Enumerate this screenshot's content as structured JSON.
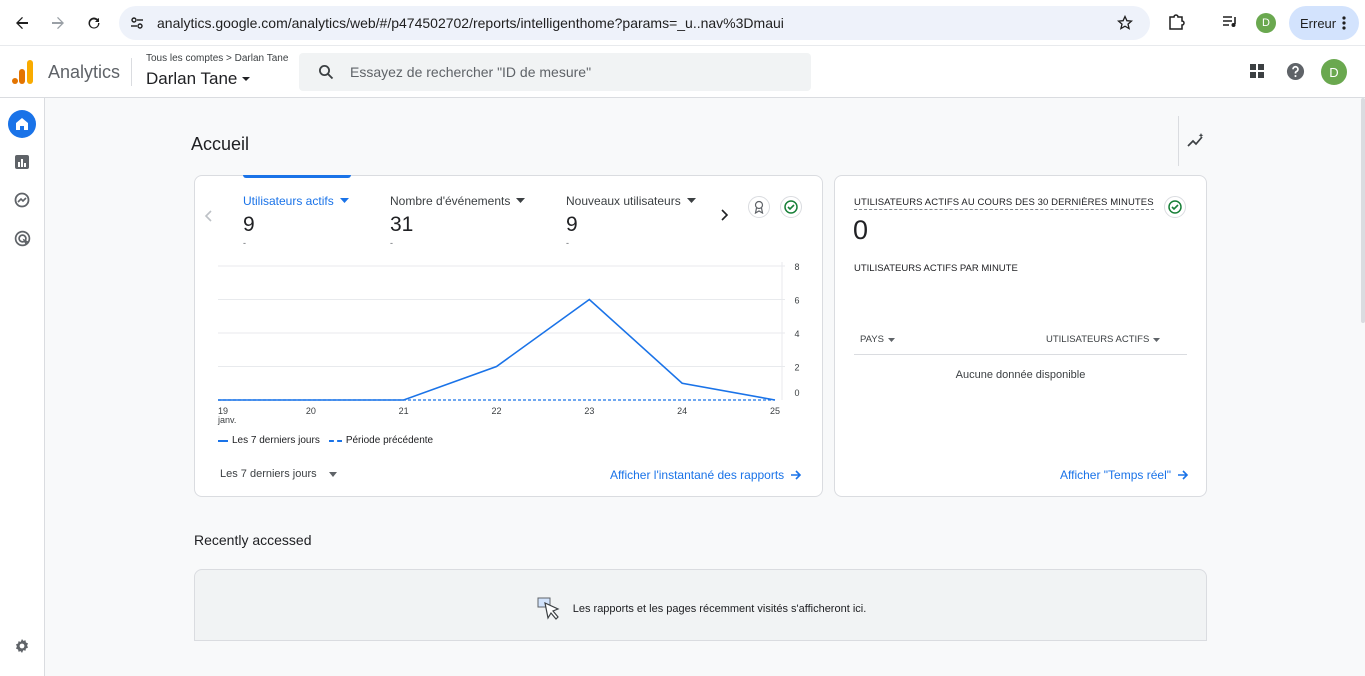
{
  "browser": {
    "url": "analytics.google.com/analytics/web/#/p474502702/reports/intelligenthome?params=_u..nav%3Dmaui",
    "profile_initial": "D",
    "error_label": "Erreur"
  },
  "header": {
    "brand": "Analytics",
    "breadcrumb": "Tous les comptes > Darlan Tane",
    "account": "Darlan Tane",
    "search_placeholder": "Essayez de rechercher \"ID de mesure\"",
    "avatar_initial": "D"
  },
  "page": {
    "title": "Accueil"
  },
  "overview_card": {
    "tabs": [
      {
        "label": "Utilisateurs actifs",
        "value": "9",
        "sub": "-"
      },
      {
        "label": "Nombre d'événements",
        "value": "31",
        "sub": "-"
      },
      {
        "label": "Nouveaux utilisateurs",
        "value": "9",
        "sub": "-"
      }
    ],
    "legend_current": "Les 7 derniers jours",
    "legend_previous": "Période précédente",
    "date_range": "Les 7 derniers jours",
    "link": "Afficher l'instantané des rapports"
  },
  "chart_data": {
    "type": "line",
    "x": [
      "19 janv.",
      "20",
      "21",
      "22",
      "23",
      "24",
      "25"
    ],
    "series": [
      {
        "name": "Les 7 derniers jours",
        "values": [
          0,
          0,
          0,
          2,
          6,
          1,
          0
        ]
      },
      {
        "name": "Période précédente",
        "values": [
          0,
          0,
          0,
          0,
          0,
          0,
          0
        ]
      }
    ],
    "y_ticks": [
      "8",
      "6",
      "4",
      "2",
      "0"
    ],
    "ylim": [
      0,
      8
    ],
    "grid": true,
    "y_axis_side": "right",
    "colors": {
      "current": "#1a73e8",
      "previous": "#1a73e8"
    }
  },
  "realtime_card": {
    "title": "UTILISATEURS ACTIFS AU COURS DES 30 DERNIÈRES MINUTES",
    "value": "0",
    "subtitle": "UTILISATEURS ACTIFS PAR MINUTE",
    "col_country": "PAYS",
    "col_users": "UTILISATEURS ACTIFS",
    "empty": "Aucune donnée disponible",
    "link": "Afficher \"Temps réel\""
  },
  "recent": {
    "title": "Recently accessed",
    "message": "Les rapports et les pages récemment visités s'afficheront ici."
  },
  "colors": {
    "accent": "#1a73e8",
    "success": "#188038",
    "avatar": "#6aa84f"
  }
}
